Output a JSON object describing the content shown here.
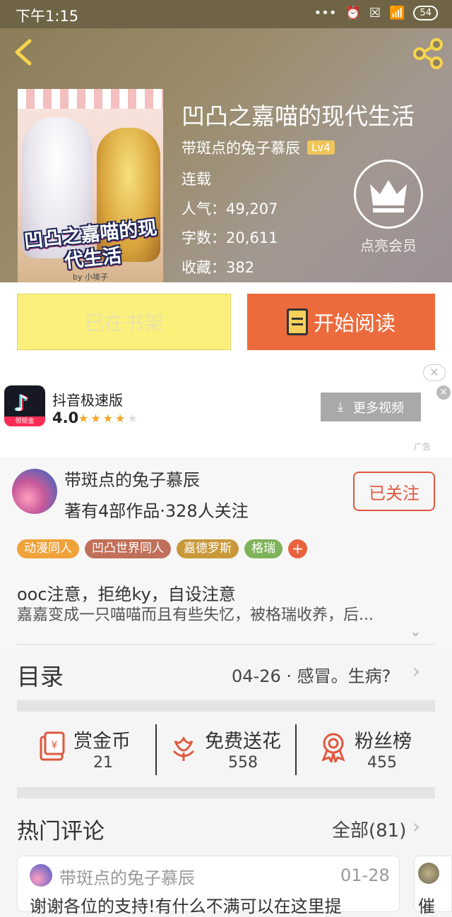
{
  "status_bar": {
    "time": "下午1:15",
    "battery": "54"
  },
  "book": {
    "cover_title": "凹凸之嘉喵的现代生活",
    "cover_byline": "by 小埃子",
    "title": "凹凸之嘉喵的现代生活",
    "author": "带斑点的兔子慕辰",
    "level": "Lv4",
    "status": "连载",
    "popularity_label": "人气：",
    "popularity": "49,207",
    "words_label": "字数：",
    "words": "20,611",
    "favorites_label": "收藏：",
    "favorites": "382",
    "vip_label": "点亮会员"
  },
  "actions": {
    "shelf_label": "已在书架",
    "read_label": "开始阅读"
  },
  "ad": {
    "app_name": "抖音极速版",
    "icon_strip": "领现金",
    "rating": "4.0",
    "stars_on": "★★★★",
    "stars_off": "★",
    "more_label": "更多视频",
    "tag": "广告"
  },
  "author_section": {
    "name": "带斑点的兔子慕辰",
    "stats": "著有4部作品·328人关注",
    "follow_label": "已关注",
    "tags": [
      {
        "label": "动漫同人",
        "color": "#f0a23a"
      },
      {
        "label": "凹凸世界同人",
        "color": "#c0705a"
      },
      {
        "label": "嘉德罗斯",
        "color": "#c9983a"
      },
      {
        "label": "格瑞",
        "color": "#7fb35a"
      }
    ],
    "tag_plus": "+",
    "desc_line1": "ooc注意，拒绝ky，自设注意",
    "desc_line2": "嘉嘉变成一只喵喵而且有些失忆，被格瑞收养，后..."
  },
  "catalog": {
    "label": "目录",
    "latest": "04-26 · 感冒。生病?"
  },
  "stats": [
    {
      "label": "赏金币",
      "value": "21",
      "icon": "reward-envelope-icon"
    },
    {
      "label": "免费送花",
      "value": "558",
      "icon": "flower-icon"
    },
    {
      "label": "粉丝榜",
      "value": "455",
      "icon": "medal-icon"
    }
  ],
  "comments": {
    "label": "热门评论",
    "all_label": "全部(81)",
    "first": {
      "name": "带斑点的兔子慕辰",
      "date": "01-28",
      "text": "谢谢各位的支持!有什么不满可以在这里提"
    },
    "second_partial_text": "催"
  },
  "colors": {
    "accent": "#ec6b3d",
    "shelf": "#fbf07b",
    "follow": "#e0573d"
  }
}
